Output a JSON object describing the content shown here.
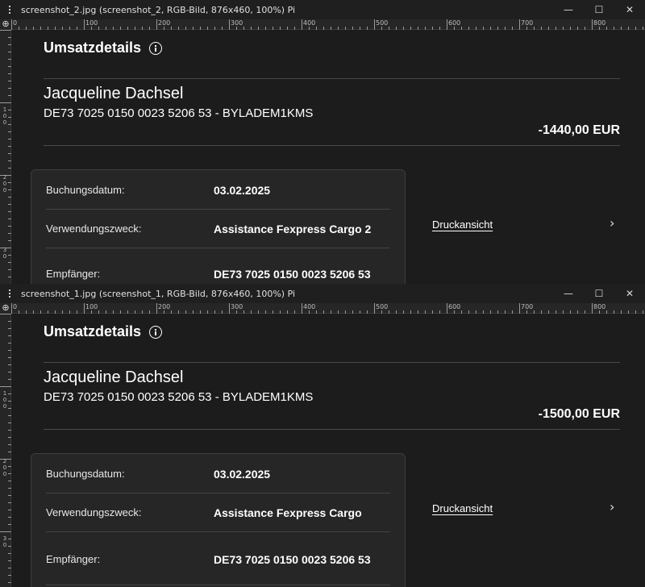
{
  "windows": [
    {
      "title": "screenshot_2.jpg (screenshot_2, RGB-Bild, 876x460, 100%) Pi",
      "heading": "Umsatzdetails",
      "name": "Jacqueline Dachsel",
      "iban": "DE73 7025 0150 0023 5206 53 - BYLADEM1KMS",
      "amount": "-1440,00 EUR",
      "rows": [
        {
          "label": "Buchungsdatum:",
          "value": "03.02.2025"
        },
        {
          "label": "Verwendungszweck:",
          "value": "Assistance Fexpress Cargo 2"
        },
        {
          "label": "Empfänger:",
          "value": "DE73 7025 0150 0023 5206 53"
        }
      ],
      "print_link": "Druckansicht"
    },
    {
      "title": "screenshot_1.jpg (screenshot_1, RGB-Bild, 876x460, 100%) Pi",
      "heading": "Umsatzdetails",
      "name": "Jacqueline Dachsel",
      "iban": "DE73 7025 0150 0023 5206 53 - BYLADEM1KMS",
      "amount": "-1500,00 EUR",
      "rows": [
        {
          "label": "Buchungsdatum:",
          "value": "03.02.2025"
        },
        {
          "label": "Verwendungszweck:",
          "value": "Assistance Fexpress Cargo"
        },
        {
          "label": "Empfänger:",
          "value": "DE73 7025 0150 0023 5206 53"
        }
      ],
      "print_link": "Druckansicht"
    }
  ],
  "window_controls": {
    "minimize": "—",
    "maximize": "☐",
    "close": "✕"
  },
  "ruler_corner": "⊕",
  "ruler_labels": [
    "0",
    "100",
    "200",
    "300",
    "400",
    "500",
    "600",
    "700",
    "800"
  ],
  "ruler_v_labels": [
    "1",
    "0",
    "0",
    "2",
    "0",
    "0",
    "3",
    "0"
  ],
  "chevron": "›",
  "icons": {
    "info": "info-circle-icon",
    "menu": "menu-dots-icon",
    "chevron": "chevron-right-icon"
  },
  "colors": {
    "background": "#1c1c1c",
    "card": "#262626",
    "text": "#ffffff",
    "divider": "#4a4a4a"
  }
}
